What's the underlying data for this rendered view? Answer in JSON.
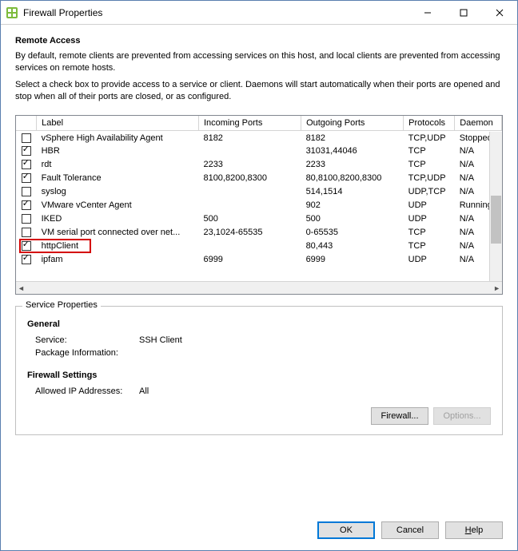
{
  "window": {
    "title": "Firewall Properties"
  },
  "header": {
    "title": "Remote Access",
    "desc1": "By default, remote clients are prevented from accessing services on this host, and local clients are prevented from accessing services on remote hosts.",
    "desc2": "Select a check box to provide access to a service or client. Daemons will start automatically when their ports are opened and stop when all of their ports are closed, or as configured."
  },
  "columns": {
    "label": "Label",
    "incoming": "Incoming Ports",
    "outgoing": "Outgoing Ports",
    "protocols": "Protocols",
    "daemon": "Daemon"
  },
  "rows": [
    {
      "checked": false,
      "label": "vSphere High Availability Agent",
      "incoming": "8182",
      "outgoing": "8182",
      "protocols": "TCP,UDP",
      "daemon": "Stopped"
    },
    {
      "checked": true,
      "label": "HBR",
      "incoming": "",
      "outgoing": "31031,44046",
      "protocols": "TCP",
      "daemon": "N/A"
    },
    {
      "checked": true,
      "label": "rdt",
      "incoming": "2233",
      "outgoing": "2233",
      "protocols": "TCP",
      "daemon": "N/A"
    },
    {
      "checked": true,
      "label": "Fault Tolerance",
      "incoming": "8100,8200,8300",
      "outgoing": "80,8100,8200,8300",
      "protocols": "TCP,UDP",
      "daemon": "N/A"
    },
    {
      "checked": false,
      "label": "syslog",
      "incoming": "",
      "outgoing": "514,1514",
      "protocols": "UDP,TCP",
      "daemon": "N/A"
    },
    {
      "checked": true,
      "label": "VMware vCenter Agent",
      "incoming": "",
      "outgoing": "902",
      "protocols": "UDP",
      "daemon": "Running"
    },
    {
      "checked": false,
      "label": "IKED",
      "incoming": "500",
      "outgoing": "500",
      "protocols": "UDP",
      "daemon": "N/A"
    },
    {
      "checked": false,
      "label": "VM serial port connected over net...",
      "incoming": "23,1024-65535",
      "outgoing": "0-65535",
      "protocols": "TCP",
      "daemon": "N/A"
    },
    {
      "checked": true,
      "label": "httpClient",
      "incoming": "",
      "outgoing": "80,443",
      "protocols": "TCP",
      "daemon": "N/A",
      "highlight": true
    },
    {
      "checked": true,
      "label": "ipfam",
      "incoming": "6999",
      "outgoing": "6999",
      "protocols": "UDP",
      "daemon": "N/A"
    }
  ],
  "serviceProps": {
    "legend": "Service Properties",
    "generalTitle": "General",
    "serviceLabel": "Service:",
    "serviceValue": "SSH Client",
    "packageLabel": "Package Information:",
    "packageValue": "",
    "firewallTitle": "Firewall Settings",
    "allowedLabel": "Allowed IP Addresses:",
    "allowedValue": "All",
    "firewallBtn": "Firewall...",
    "optionsBtn": "Options..."
  },
  "buttons": {
    "ok": "OK",
    "cancel": "Cancel",
    "help": "Help"
  }
}
